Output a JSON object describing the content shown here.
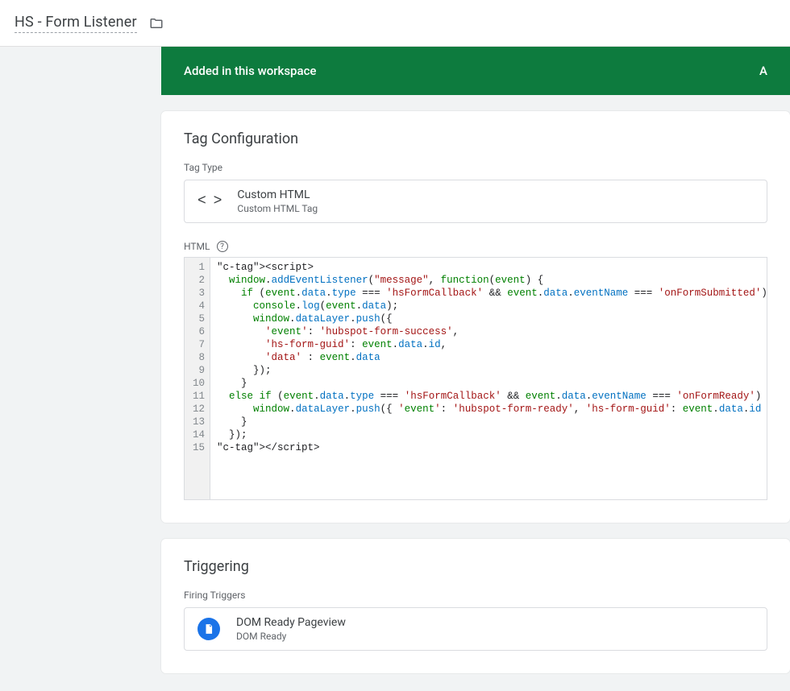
{
  "header": {
    "title": "HS - Form Listener"
  },
  "banner": {
    "text": "Added in this workspace",
    "action_hint": "A"
  },
  "tag_config": {
    "heading": "Tag Configuration",
    "tag_type_label": "Tag Type",
    "type": {
      "name": "Custom HTML",
      "sub": "Custom HTML Tag"
    },
    "html_label": "HTML",
    "line_count": 15,
    "code_lines": {
      "l1": "<script>",
      "l2": "  window.addEventListener(\"message\", function(event) {",
      "l3": "    if (event.data.type === 'hsFormCallback' && event.data.eventName === 'onFormSubmitted') {",
      "l4": "      console.log(event.data);",
      "l5": "      window.dataLayer.push({",
      "l6": "        'event': 'hubspot-form-success',",
      "l7": "        'hs-form-guid': event.data.id,",
      "l8": "        'data' : event.data",
      "l9": "      });",
      "l10": "    }",
      "l11": "  else if (event.data.type === 'hsFormCallback' && event.data.eventName === 'onFormReady')  {",
      "l12": "      window.dataLayer.push({ 'event': 'hubspot-form-ready', 'hs-form-guid': event.data.id });",
      "l13": "    }",
      "l14": "  });",
      "l15": "</script>"
    }
  },
  "triggering": {
    "heading": "Triggering",
    "firing_label": "Firing Triggers",
    "trigger": {
      "name": "DOM Ready Pageview",
      "type": "DOM Ready"
    }
  }
}
